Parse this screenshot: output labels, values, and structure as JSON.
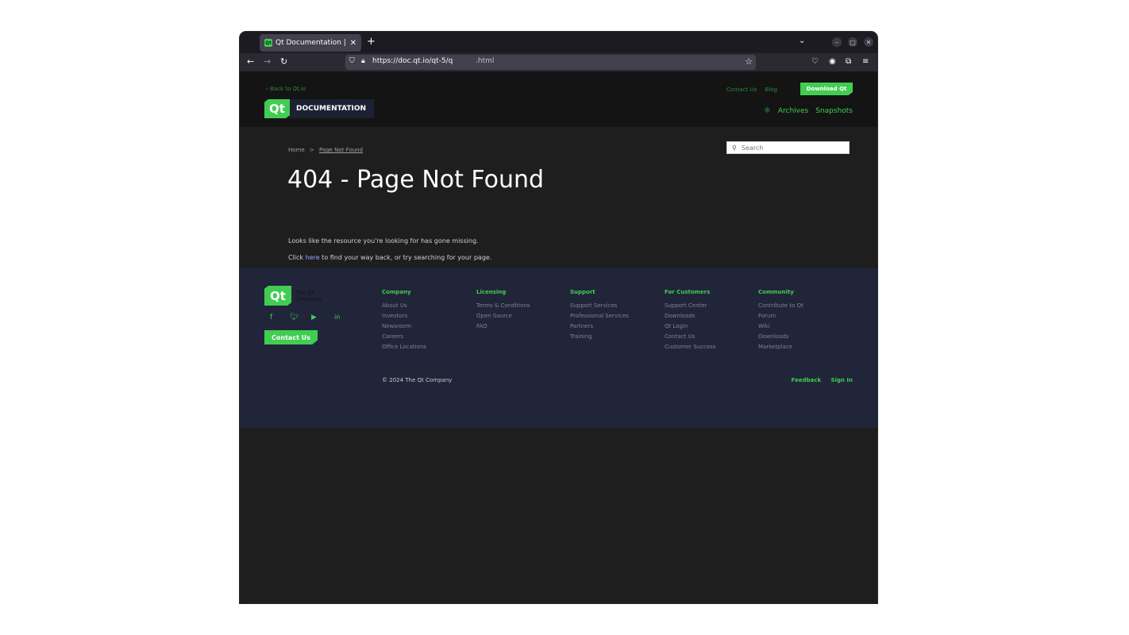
{
  "browser": {
    "tab_title": "Qt Documentation | Page Not Found",
    "tab_favicon": "Qt",
    "new_tab": "+",
    "url_host": "https://doc.qt.io/qt-5/q",
    "url_tail": ".html"
  },
  "header": {
    "back_link": "‹ Back to Qt.io",
    "contact": "Contact Us",
    "blog": "Blog",
    "download_button": "Download Qt",
    "logo_text": "Qt",
    "doc_label": "DOCUMENTATION",
    "archives": "Archives",
    "snapshots": "Snapshots"
  },
  "main": {
    "breadcrumb_home": "Home",
    "breadcrumb_sep": ">",
    "breadcrumb_current": "Page Not Found",
    "search_placeholder": "Search",
    "title": "404 - Page Not Found",
    "line1": "Looks like the resource you're looking for has gone missing.",
    "line2_pre": "Click ",
    "line2_link": "here",
    "line2_post": " to find your way back, or try searching for your page."
  },
  "footer": {
    "logo_text": "Qt",
    "company_line1": "The Qt",
    "company_line2": "Company",
    "contact_button": "Contact Us",
    "columns": [
      {
        "heading": "Company",
        "items": [
          "About Us",
          "Investors",
          "Newsroom",
          "Careers",
          "Office Locations"
        ]
      },
      {
        "heading": "Licensing",
        "items": [
          "Terms & Conditions",
          "Open Source",
          "FAQ"
        ]
      },
      {
        "heading": "Support",
        "items": [
          "Support Services",
          "Professional Services",
          "Partners",
          "Training"
        ]
      },
      {
        "heading": "For Customers",
        "items": [
          "Support Center",
          "Downloads",
          "Qt Login",
          "Contact Us",
          "Customer Success"
        ]
      },
      {
        "heading": "Community",
        "items": [
          "Contribute to Qt",
          "Forum",
          "Wiki",
          "Downloads",
          "Marketplace"
        ]
      }
    ],
    "copyright": "© 2024 The Qt Company",
    "feedback": "Feedback",
    "sign_in": "Sign In"
  },
  "colors": {
    "accent": "#41cd52",
    "footer_bg": "#212539",
    "page_bg": "#1e1e1e"
  }
}
